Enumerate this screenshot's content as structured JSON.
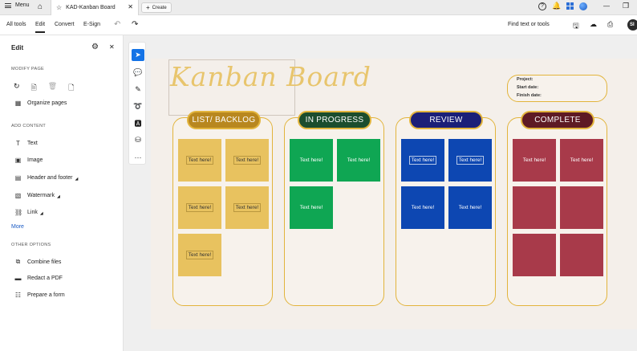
{
  "tabbar": {
    "menu_label": "Menu",
    "doc_tab_title": "KAD-Kanban Board",
    "create_label": "Create"
  },
  "toolbar": {
    "items": [
      "All tools",
      "Edit",
      "Convert",
      "E-Sign"
    ],
    "find_label": "Find text or tools",
    "avatar_initials": "SI"
  },
  "left_panel": {
    "title": "Edit",
    "modify_heading": "MODIFY PAGE",
    "organize_label": "Organize pages",
    "add_heading": "ADD CONTENT",
    "add_items": [
      "Text",
      "Image",
      "Header and footer",
      "Watermark",
      "Link"
    ],
    "more_label": "More",
    "other_heading": "OTHER OPTIONS",
    "other_items": [
      "Combine files",
      "Redact a PDF",
      "Prepare a form"
    ]
  },
  "board": {
    "title": "Kanban Board",
    "info": [
      "Project:",
      "Start date:",
      "Finish date:"
    ],
    "columns": [
      {
        "label": "LIST/ BACKLOG",
        "color": "#b8871f"
      },
      {
        "label": "IN PROGRESS",
        "color": "#1b4d2e"
      },
      {
        "label": "REVIEW",
        "color": "#1b1f78"
      },
      {
        "label": "COMPLETE",
        "color": "#5e1a24"
      }
    ],
    "note_text": "Text here!"
  }
}
